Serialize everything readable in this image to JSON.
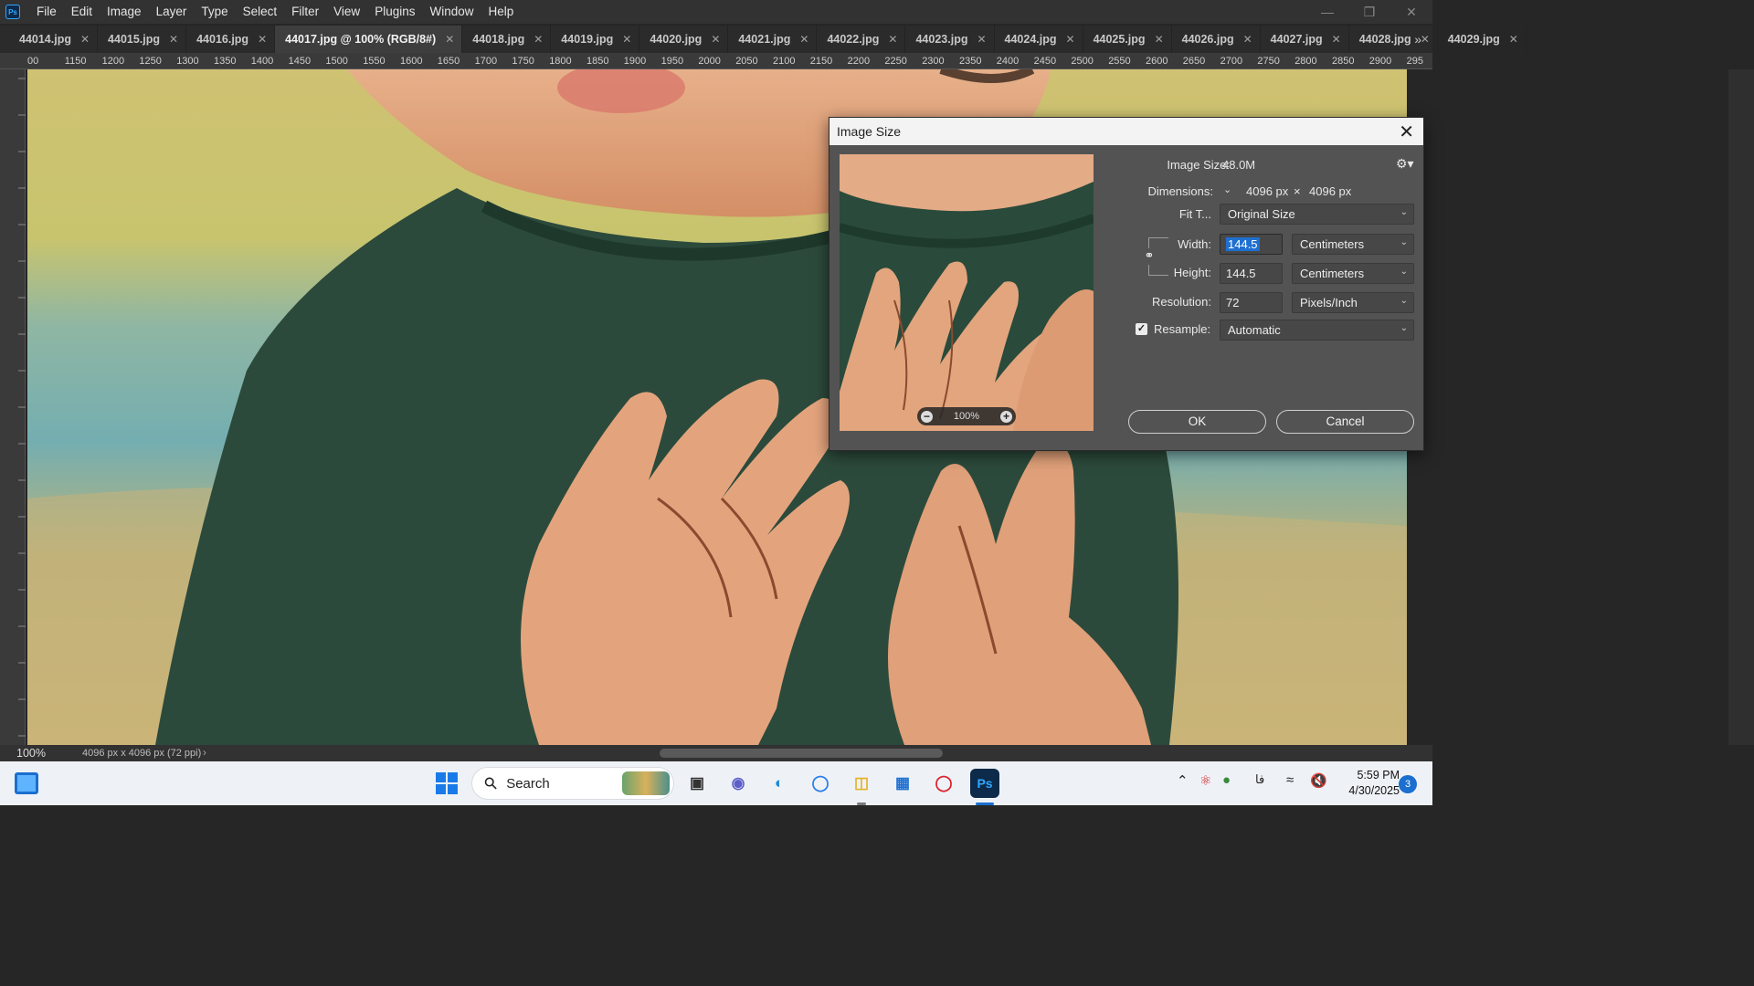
{
  "menu": [
    "File",
    "Edit",
    "Image",
    "Layer",
    "Type",
    "Select",
    "Filter",
    "View",
    "Plugins",
    "Window",
    "Help"
  ],
  "tabs": [
    {
      "label": "44014.jpg",
      "active": false
    },
    {
      "label": "44015.jpg",
      "active": false
    },
    {
      "label": "44016.jpg",
      "active": false
    },
    {
      "label": "44017.jpg @ 100% (RGB/8#)",
      "active": true
    },
    {
      "label": "44018.jpg",
      "active": false
    },
    {
      "label": "44019.jpg",
      "active": false
    },
    {
      "label": "44020.jpg",
      "active": false
    },
    {
      "label": "44021.jpg",
      "active": false
    },
    {
      "label": "44022.jpg",
      "active": false
    },
    {
      "label": "44023.jpg",
      "active": false
    },
    {
      "label": "44024.jpg",
      "active": false
    },
    {
      "label": "44025.jpg",
      "active": false
    },
    {
      "label": "44026.jpg",
      "active": false
    },
    {
      "label": "44027.jpg",
      "active": false
    },
    {
      "label": "44028.jpg",
      "active": false
    },
    {
      "label": "44029.jpg",
      "active": false
    }
  ],
  "ruler_h": [
    "00",
    "1150",
    "1200",
    "1250",
    "1300",
    "1350",
    "1400",
    "1450",
    "1500",
    "1550",
    "1600",
    "1650",
    "1700",
    "1750",
    "1800",
    "1850",
    "1900",
    "1950",
    "2000",
    "2050",
    "2100",
    "2150",
    "2200",
    "2250",
    "2300",
    "2350",
    "2400",
    "2450",
    "2500",
    "2550",
    "2600",
    "2650",
    "2700",
    "2750",
    "2800",
    "2850",
    "2900",
    "295"
  ],
  "status": {
    "zoom": "100%",
    "doc_info": "4096 px x 4096 px (72 ppi)"
  },
  "dialog": {
    "title": "Image Size",
    "close_icon": "close-icon",
    "preview_zoom": "100%",
    "image_size_label": "Image Size:",
    "image_size_value": "48.0M",
    "dimensions_label": "Dimensions:",
    "dim_width": "4096 px",
    "dim_times": "×",
    "dim_height": "4096 px",
    "fit_to_label": "Fit T...",
    "fit_to_value": "Original Size",
    "width_label": "Width:",
    "width_value": "144.5",
    "width_unit": "Centimeters",
    "height_label": "Height:",
    "height_value": "144.5",
    "height_unit": "Centimeters",
    "resolution_label": "Resolution:",
    "resolution_value": "72",
    "resolution_unit": "Pixels/Inch",
    "resample_label": "Resample:",
    "resample_checked": true,
    "resample_value": "Automatic",
    "ok_label": "OK",
    "cancel_label": "Cancel"
  },
  "taskbar": {
    "search_placeholder": "Search",
    "apps": [
      "task-view",
      "meet",
      "edge",
      "lens",
      "file-explorer",
      "store",
      "opera",
      "photoshop"
    ],
    "ps_label": "Ps",
    "lang": "فا",
    "time": "5:59 PM",
    "date": "4/30/2025",
    "notifications": "3"
  },
  "colors": {
    "ps_blue": "#31a8ff",
    "shirt_green": "#2c4a3b",
    "skin": "#e0a07a",
    "accent_blue": "#1a6fcf"
  }
}
